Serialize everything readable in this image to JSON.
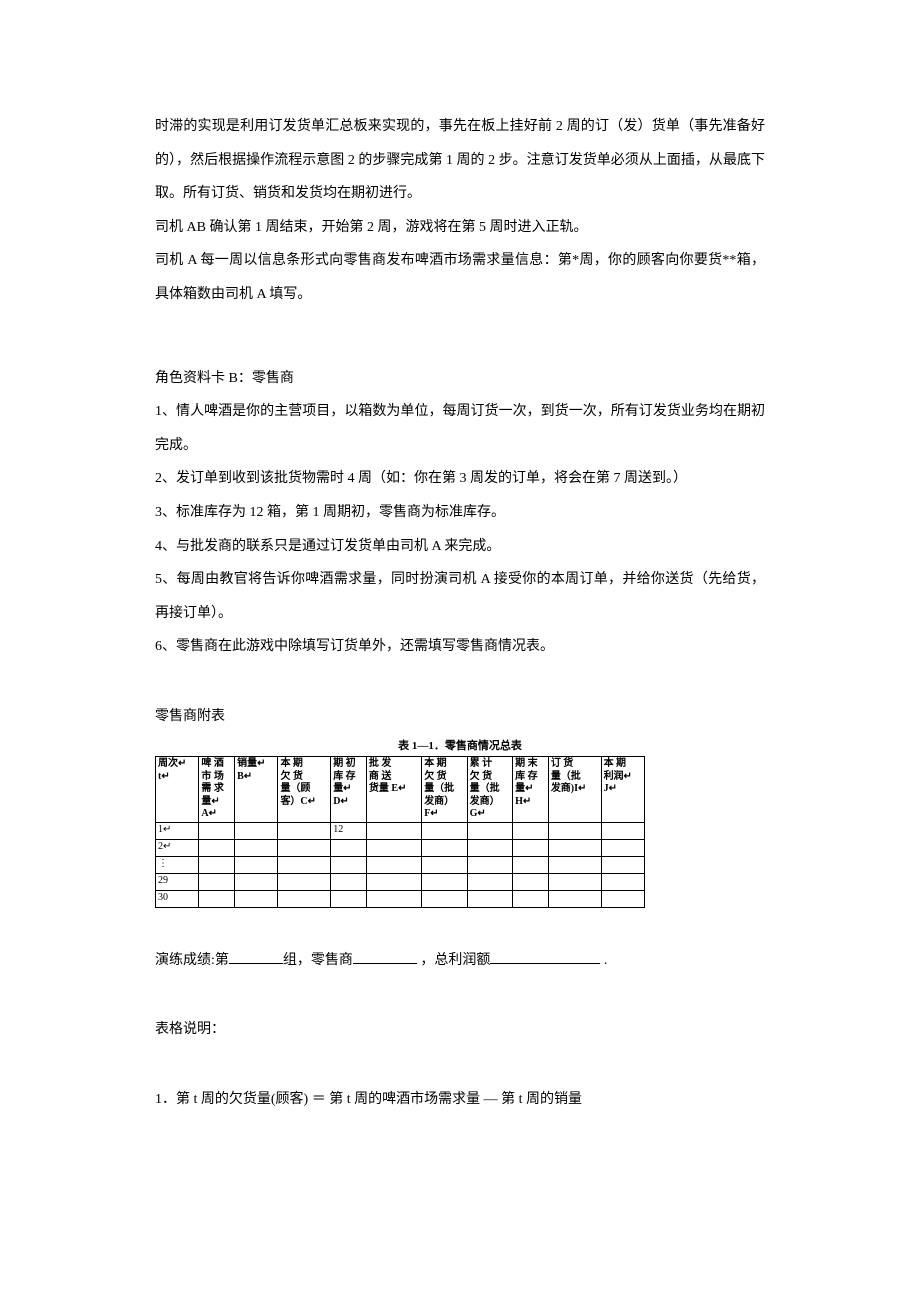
{
  "intro": {
    "p1": "时滞的实现是利用订发货单汇总板来实现的，事先在板上挂好前 2 周的订（发）货单（事先准备好的），然后根据操作流程示意图 2 的步骤完成第 1 周的 2 步。注意订发货单必须从上面插，从最底下取。所有订货、销货和发货均在期初进行。",
    "p2": "司机 AB 确认第 1 周结束，开始第 2 周，游戏将在第 5 周时进入正轨。",
    "p3": "司机 A 每一周以信息条形式向零售商发布啤酒市场需求量信息：第*周，你的顾客向你要货**箱，具体箱数由司机 A 填写。"
  },
  "roleCard": {
    "title": "角色资料卡 B：零售商",
    "items": [
      "1、情人啤酒是你的主营项目，以箱数为单位，每周订货一次，到货一次，所有订发货业务均在期初完成。",
      "2、发订单到收到该批货物需时 4 周（如：你在第 3 周发的订单，将会在第 7 周送到。）",
      "3、标准库存为 12 箱，第 1 周期初，零售商为标准库存。",
      "4、与批发商的联系只是通过订发货单由司机 A 来完成。",
      "5、每周由教官将告诉你啤酒需求量，同时扮演司机 A 接受你的本周订单，并给你送货（先给货，再接订单）。",
      "6、零售商在此游戏中除填写订货单外，还需填写零售商情况表。"
    ]
  },
  "attachTitle": "零售商附表",
  "tableTitle": "表 1—1．零售商情况总表",
  "headers": {
    "h1a": "周次↵",
    "h1b": "t↵",
    "h2a": "啤 酒",
    "h2b": "市 场",
    "h2c": "需 求",
    "h2d": "量↵",
    "h2e": "A↵",
    "h3a": "销量↵",
    "h3b": "B↵",
    "h4a": "本 期",
    "h4b": "欠 货",
    "h4c": "量（顾",
    "h4d": "客）C↵",
    "h5a": "期 初",
    "h5b": "库 存",
    "h5c": "量↵",
    "h5d": "D↵",
    "h6a": "批 发",
    "h6b": "商 送",
    "h6c": "货量 E↵",
    "h7a": "本 期",
    "h7b": "欠 货",
    "h7c": "量（批",
    "h7d": "发商）",
    "h7e": "F↵",
    "h8a": "累 计",
    "h8b": "欠 货",
    "h8c": "量（批",
    "h8d": "发商）",
    "h8e": "G↵",
    "h9a": "期 末",
    "h9b": "库 存",
    "h9c": "量↵",
    "h9d": "H↵",
    "h10a": "订 货",
    "h10b": "量（批",
    "h10c": "发商)I↵",
    "h11a": "本 期",
    "h11b": "利润↵",
    "h11c": "J↵"
  },
  "rows": {
    "r1": "1↵",
    "r1d": "12",
    "r2": "2↵",
    "rdots": "⋮",
    "r29": "29",
    "r30": "30"
  },
  "score": {
    "prefix": "演练成绩:第",
    "mid1": "组，零售商",
    "mid2": "，总利润额",
    "end": "."
  },
  "explainTitle": "表格说明：",
  "formula1": "1．第 t 周的欠货量(顾客) ＝ 第 t 周的啤酒市场需求量  —  第 t 周的销量"
}
